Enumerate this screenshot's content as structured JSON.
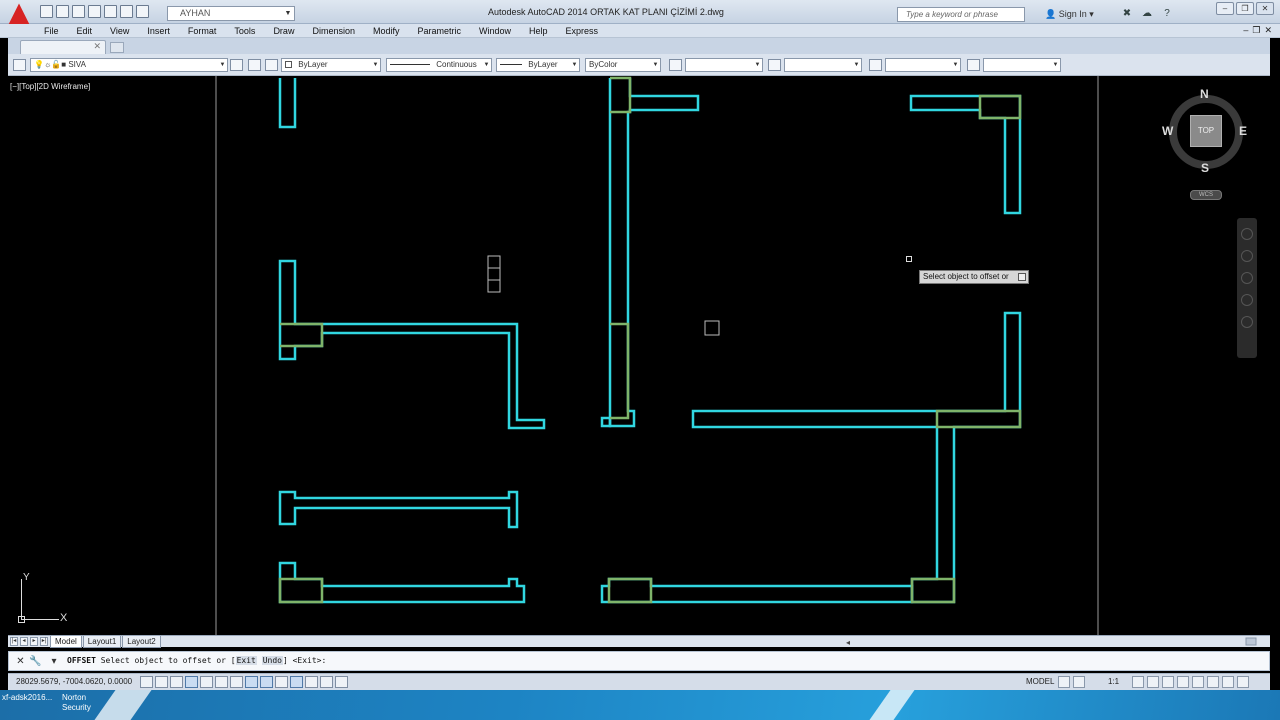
{
  "window": {
    "title": "Autodesk AutoCAD 2014    ORTAK KAT PLANI ÇİZİMİ 2.dwg",
    "workspace": "AYHAN",
    "search_placeholder": "Type a keyword or phrase",
    "sign_in": "Sign In",
    "minimize": "–",
    "restore": "❐",
    "close": "✕"
  },
  "menu": {
    "items": [
      "File",
      "Edit",
      "View",
      "Insert",
      "Format",
      "Tools",
      "Draw",
      "Dimension",
      "Modify",
      "Parametric",
      "Window",
      "Help",
      "Express"
    ],
    "doc_minimize": "–",
    "doc_restore": "❐",
    "doc_close": "✕"
  },
  "tabs": {
    "close": "✕"
  },
  "properties": {
    "layer": "SIVA",
    "color": "ByLayer",
    "linetype": "Continuous",
    "lineweight": "ByLayer",
    "plotstyle": "ByColor",
    "textstyle": "",
    "dimstyle": "",
    "tablestyle": "",
    "mleaderstyle": ""
  },
  "viewport": {
    "label": "[−][Top][2D Wireframe]",
    "tooltip": "Select object to offset or",
    "wall_color": "#31d6e0",
    "secondary_color": "#7fb46a"
  },
  "viewcube": {
    "north": "N",
    "south": "S",
    "east": "E",
    "west": "W",
    "face": "TOP",
    "wcs": "WCS"
  },
  "ucs": {
    "x": "X",
    "y": "Y"
  },
  "layout_tabs": [
    "Model",
    "Layout1",
    "Layout2"
  ],
  "command": {
    "name": "OFFSET",
    "prompt": "Select object to offset or [",
    "opt_exit": "Exit",
    "opt_undo": "Undo",
    "suffix": "] <Exit>:"
  },
  "status": {
    "coords": "28029.5679, -7004.0620, 0.0000",
    "space": "MODEL",
    "annotation_scale": "1:1"
  },
  "taskbar": {
    "item1": "xf-adsk2016...",
    "item2": "Norton Security"
  }
}
